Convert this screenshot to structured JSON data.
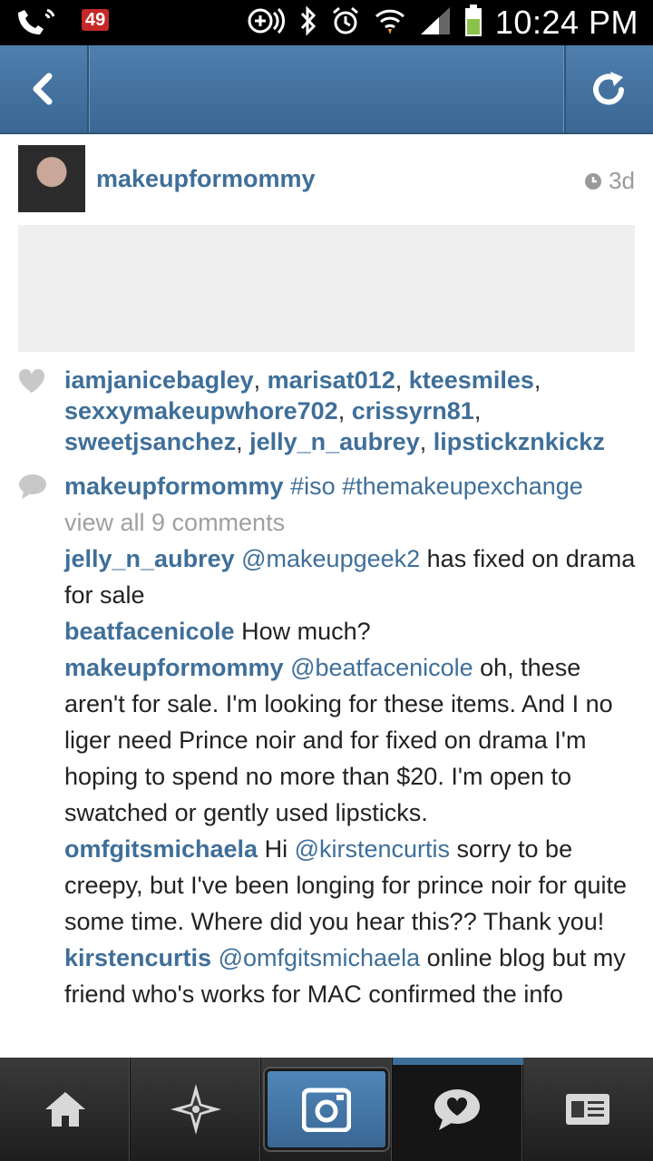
{
  "status_bar": {
    "notification_count": "49",
    "time": "10:24 PM"
  },
  "header": {
    "back_icon": "back-arrow-icon",
    "refresh_icon": "refresh-icon"
  },
  "post": {
    "username": "makeupformommy",
    "time_ago": "3d",
    "likes": [
      "iamjanicebagley",
      "marisat012",
      "kteesmiles",
      "sexxymakeupwhore702",
      "crissyrn81",
      "sweetjsanchez",
      "jelly_n_aubrey",
      "lipstickznkickz"
    ],
    "caption": {
      "user": "makeupformommy",
      "tags": "#iso #themakeupexchange"
    },
    "view_all": "view all 9 comments",
    "comments": [
      {
        "user": "jelly_n_aubrey",
        "mention": "@makeupgeek2",
        "text": " has fixed on drama for sale"
      },
      {
        "user": "beatfacenicole",
        "mention": "",
        "text": "How much?"
      },
      {
        "user": "makeupformommy",
        "mention": "@beatfacenicole",
        "text": " oh, these aren't for sale. I'm looking for these items. And I no liger need Prince noir and for fixed on drama I'm hoping to spend no more than $20. I'm open to swatched or gently used lipsticks."
      },
      {
        "user": "omfgitsmichaela",
        "pre": "Hi ",
        "mention": "@kirstencurtis",
        "text": " sorry to be creepy, but I've been longing for prince noir for quite some time. Where did you hear this?? Thank you!"
      },
      {
        "user": "kirstencurtis",
        "mention": "@omfgitsmichaela",
        "text": " online blog but my friend who's works for MAC confirmed the info"
      }
    ]
  },
  "bottom_nav": {
    "items": [
      "home-icon",
      "explore-icon",
      "camera-icon",
      "news-icon",
      "profile-icon"
    ],
    "active": "news-icon"
  },
  "colors": {
    "accent": "#3f6f99",
    "header": "#4a7aa7"
  }
}
